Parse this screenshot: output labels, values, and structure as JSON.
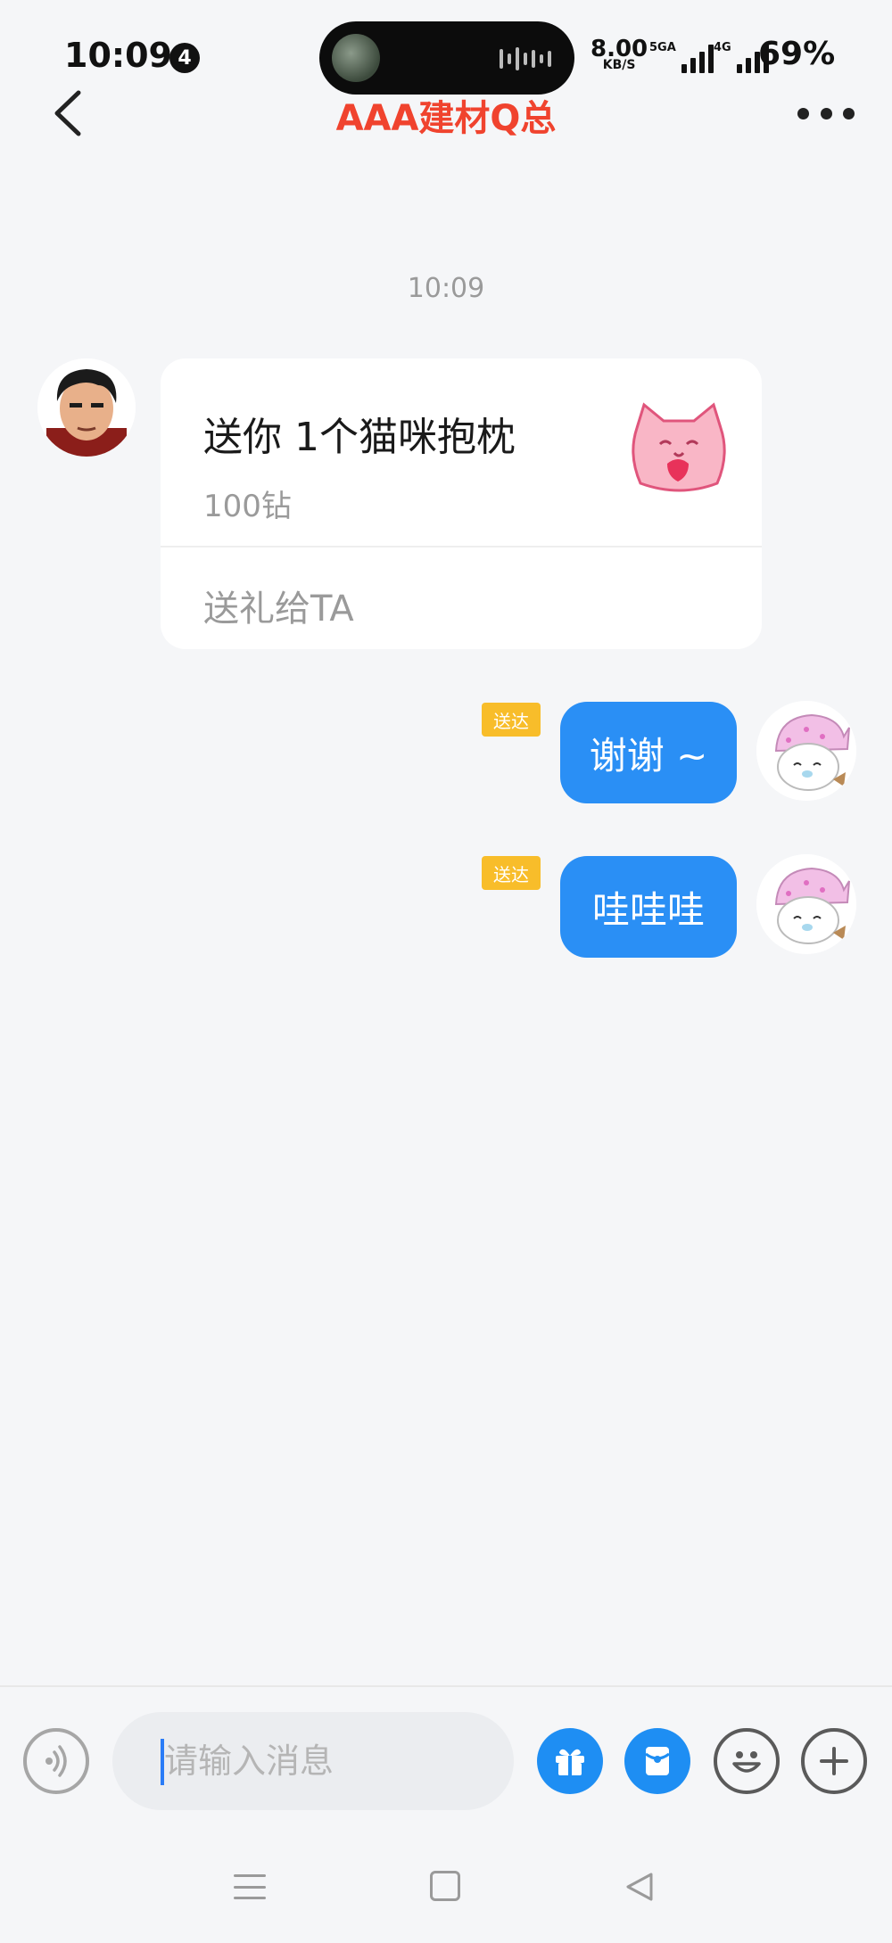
{
  "status_bar": {
    "time": "10:09",
    "notification_count": "4",
    "net_speed": "8.00",
    "net_speed_unit": "KB/S",
    "signal_1_label": "5GA",
    "signal_2_label": "4G",
    "battery": "69%"
  },
  "nav": {
    "title": "AAA建材Q总"
  },
  "chat": {
    "timestamp": "10:09",
    "gift_card": {
      "title": "送你 1个猫咪抱枕",
      "price": "100钻",
      "action": "送礼给TA"
    },
    "messages": [
      {
        "status": "送达",
        "text": "谢谢 ~"
      },
      {
        "status": "送达",
        "text": "哇哇哇"
      }
    ]
  },
  "input_bar": {
    "placeholder": "请输入消息"
  },
  "icons": {
    "back": "chevron-left-icon",
    "more": "more-dots-icon",
    "voice": "voice-icon",
    "gift": "gift-icon",
    "red_packet": "red-packet-icon",
    "emoji": "emoji-icon",
    "plus": "plus-icon"
  },
  "colors": {
    "title": "#f0432e",
    "bubble": "#2a8ff5",
    "delivered_badge": "#f8bd2a",
    "background": "#f5f6f8"
  }
}
